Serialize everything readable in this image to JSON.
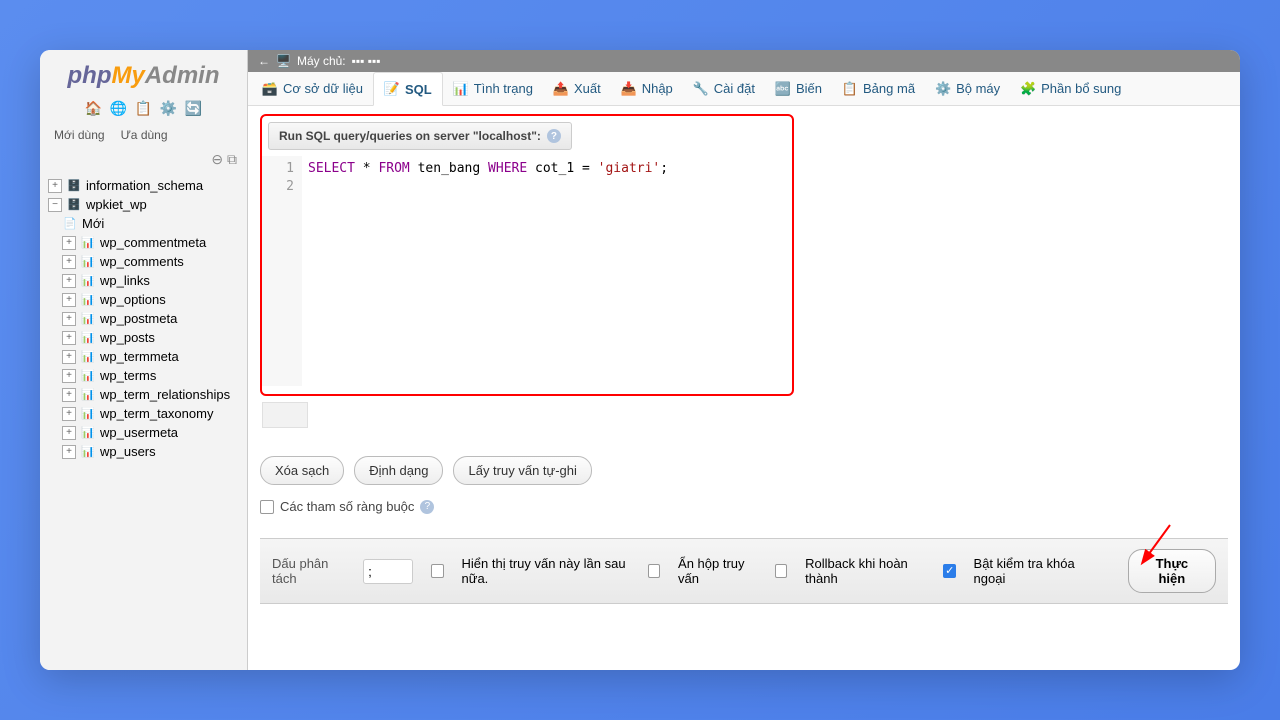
{
  "logo": {
    "php": "php",
    "my": "My",
    "admin": "Admin"
  },
  "sidebar_tabs": {
    "recent": "Mới dùng",
    "favorite": "Ưa dùng"
  },
  "tree": {
    "db1": "information_schema",
    "db2": "wpkiet_wp",
    "new_item": "Mới",
    "tables": [
      "wp_commentmeta",
      "wp_comments",
      "wp_links",
      "wp_options",
      "wp_postmeta",
      "wp_posts",
      "wp_termmeta",
      "wp_terms",
      "wp_term_relationships",
      "wp_term_taxonomy",
      "wp_usermeta",
      "wp_users"
    ]
  },
  "topbar": {
    "server_label": "Máy chủ:"
  },
  "navtabs": [
    "Cơ sở dữ liệu",
    "SQL",
    "Tình trạng",
    "Xuất",
    "Nhập",
    "Cài đặt",
    "Biến",
    "Bảng mã",
    "Bộ máy",
    "Phần bổ sung"
  ],
  "query_label": "Run SQL query/queries on server \"localhost\":",
  "sql": {
    "line1_kw1": "SELECT",
    "line1_star": "*",
    "line1_kw2": "FROM",
    "line1_tbl": "ten_bang",
    "line1_kw3": "WHERE",
    "line1_col": "cot_1 =",
    "line1_str": "'giatri'",
    "line1_end": ";"
  },
  "gutter": {
    "l1": "1",
    "l2": "2"
  },
  "buttons": {
    "clear": "Xóa sạch",
    "format": "Định dạng",
    "autosave": "Lấy truy vấn tự-ghi"
  },
  "bind_params": "Các tham số ràng buộc",
  "footer": {
    "delimiter_label": "Dấu phân tách",
    "delimiter_value": ";",
    "show_again": "Hiển thị truy vấn này lần sau nữa.",
    "hide_query": "Ẩn hộp truy vấn",
    "rollback": "Rollback khi hoàn thành",
    "fk_check": "Bật kiểm tra khóa ngoại",
    "execute": "Thực hiện"
  }
}
